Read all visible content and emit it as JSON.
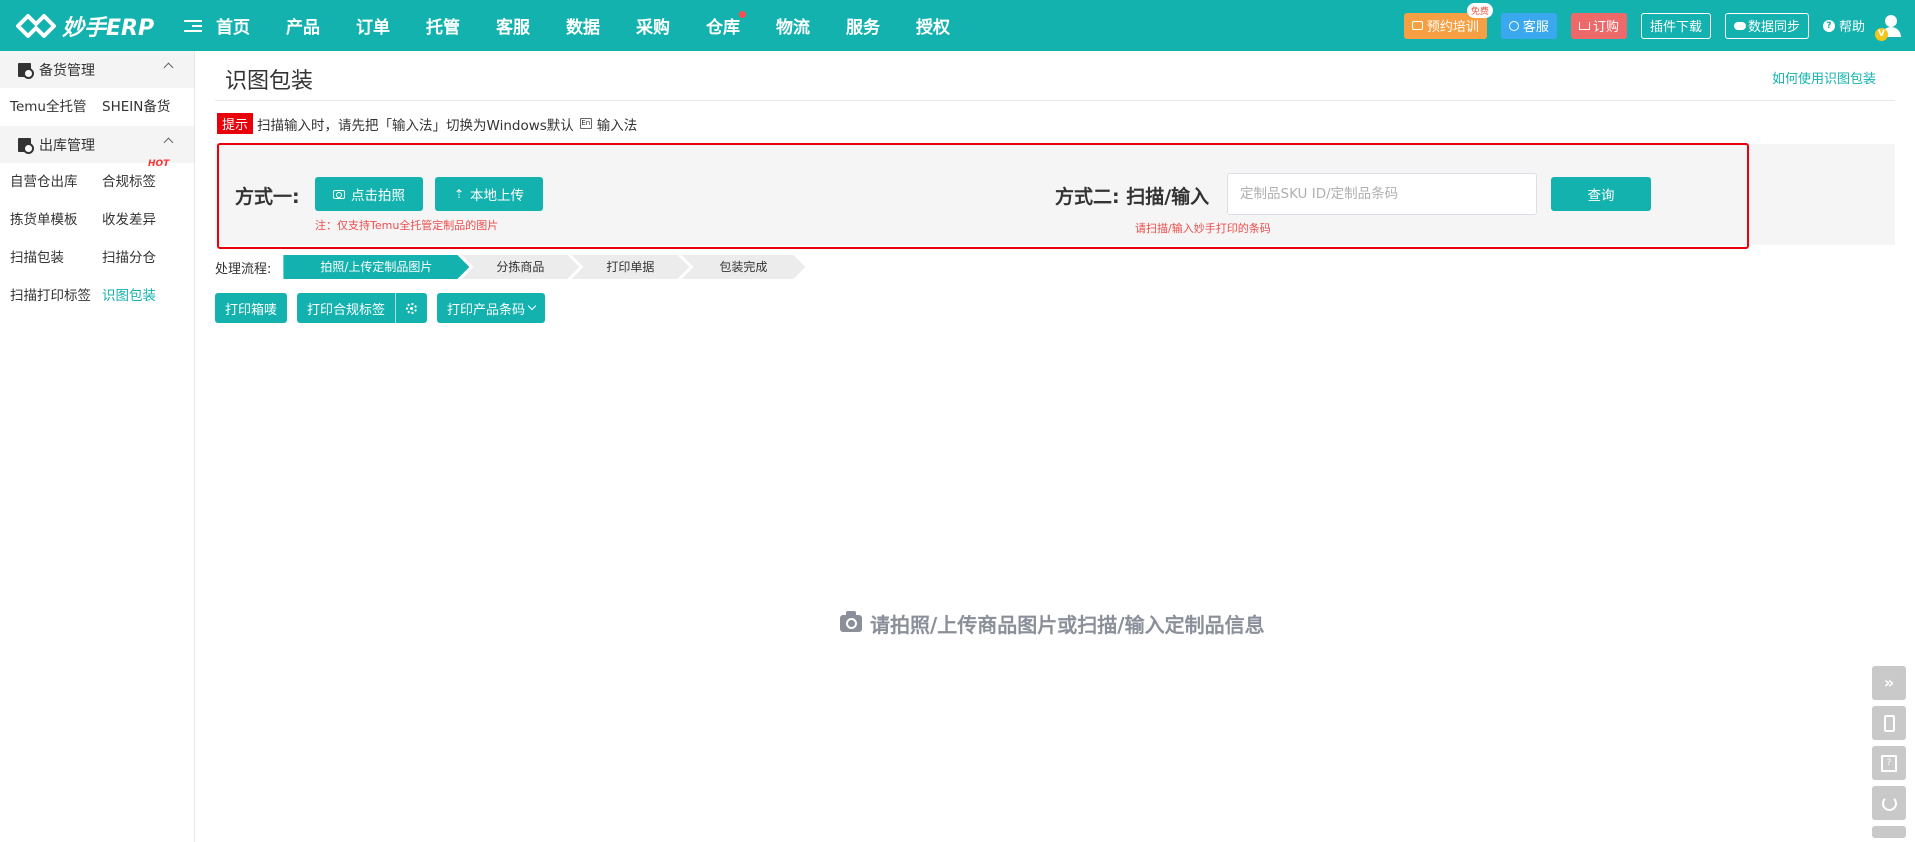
{
  "header": {
    "logo_text": "妙手ERP",
    "nav": [
      "首页",
      "产品",
      "订单",
      "托管",
      "客服",
      "数据",
      "采购",
      "仓库",
      "物流",
      "服务",
      "授权"
    ],
    "training_label": "预约培训",
    "free_badge": "免费",
    "service_label": "客服",
    "order_label": "订购",
    "plugin_label": "插件下载",
    "sync_label": "数据同步",
    "help_label": "帮助",
    "avatar_badge": "V"
  },
  "sidebar": {
    "groups": [
      {
        "title": "备货管理",
        "items": [
          "Temu全托管",
          "SHEIN备货"
        ]
      },
      {
        "title": "出库管理",
        "items": [
          "自营仓出库",
          "合规标签",
          "拣货单模板",
          "收发差异",
          "扫描包装",
          "扫描分仓",
          "扫描打印标签",
          "识图包装"
        ]
      }
    ],
    "hot_badge": "HOT"
  },
  "main": {
    "title": "识图包装",
    "help_link": "如何使用识图包装",
    "tip_tag": "提示",
    "tip_text_1": "扫描输入时，请先把「输入法」切换为Windows默认",
    "tip_kbd": "En",
    "tip_text_2": "输入法",
    "method1_label": "方式一:",
    "photo_button": "点击拍照",
    "upload_button": "本地上传",
    "method1_note": "注：仅支持Temu全托管定制品的图片",
    "method2_label": "方式二: 扫描/输入",
    "input_placeholder": "定制品SKU ID/定制品条码",
    "input_value": "",
    "query_button": "查询",
    "method2_note": "请扫描/输入妙手打印的条码",
    "flow_label": "处理流程:",
    "flow_steps": [
      "拍照/上传定制品图片",
      "分拣商品",
      "打印单据",
      "包装完成"
    ],
    "action_print_box": "打印箱唛",
    "action_print_compliance": "打印合规标签",
    "action_print_barcode": "打印产品条码",
    "empty_text": "请拍照/上传商品图片或扫描/输入定制品信息"
  },
  "colors": {
    "primary": "#13b2ae",
    "alert": "#e8000b",
    "training": "#f7a043",
    "service": "#3aa8ef",
    "order": "#ee6a6a"
  }
}
